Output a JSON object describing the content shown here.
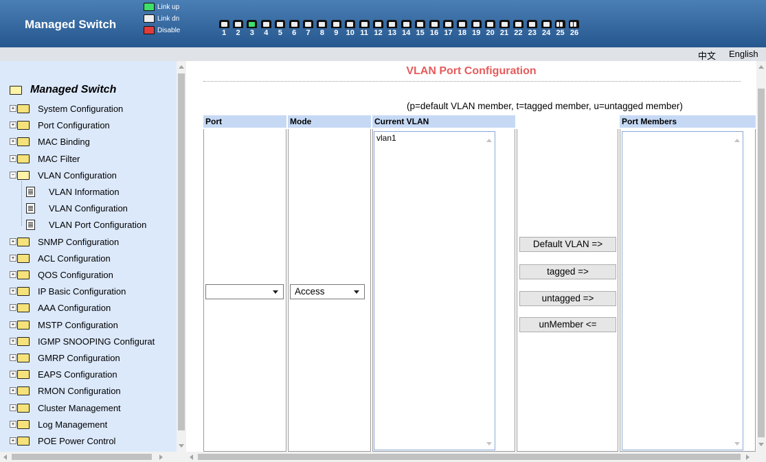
{
  "header": {
    "brand": "Managed Switch",
    "legend": [
      {
        "label": "Link up",
        "color": "#3ee06a"
      },
      {
        "label": "Link dn",
        "color": "#eeeeee"
      },
      {
        "label": "Disable",
        "color": "#e23b3b"
      }
    ],
    "ports": [
      {
        "num": "1",
        "state": "down"
      },
      {
        "num": "2",
        "state": "down"
      },
      {
        "num": "3",
        "state": "up"
      },
      {
        "num": "4",
        "state": "down"
      },
      {
        "num": "5",
        "state": "down"
      },
      {
        "num": "6",
        "state": "down"
      },
      {
        "num": "7",
        "state": "down"
      },
      {
        "num": "8",
        "state": "down"
      },
      {
        "num": "9",
        "state": "down"
      },
      {
        "num": "10",
        "state": "down"
      },
      {
        "num": "11",
        "state": "down"
      },
      {
        "num": "12",
        "state": "down"
      },
      {
        "num": "13",
        "state": "down"
      },
      {
        "num": "14",
        "state": "down"
      },
      {
        "num": "15",
        "state": "down"
      },
      {
        "num": "16",
        "state": "down"
      },
      {
        "num": "17",
        "state": "down"
      },
      {
        "num": "18",
        "state": "down"
      },
      {
        "num": "19",
        "state": "down"
      },
      {
        "num": "20",
        "state": "down"
      },
      {
        "num": "21",
        "state": "down"
      },
      {
        "num": "22",
        "state": "down"
      },
      {
        "num": "23",
        "state": "down"
      },
      {
        "num": "24",
        "state": "down"
      },
      {
        "num": "25",
        "state": "fiber"
      },
      {
        "num": "26",
        "state": "fiber"
      }
    ]
  },
  "language": {
    "chinese": "中文",
    "english": "English"
  },
  "sidebar": {
    "root": "Managed Switch",
    "items": [
      {
        "label": "System Configuration"
      },
      {
        "label": "Port Configuration"
      },
      {
        "label": "MAC Binding"
      },
      {
        "label": "MAC Filter"
      },
      {
        "label": "VLAN Configuration",
        "expanded": true,
        "children": [
          {
            "label": "VLAN Information"
          },
          {
            "label": "VLAN Configuration"
          },
          {
            "label": "VLAN Port Configuration"
          }
        ]
      },
      {
        "label": "SNMP Configuration"
      },
      {
        "label": "ACL Configuration"
      },
      {
        "label": "QOS Configuration"
      },
      {
        "label": "IP Basic Configuration"
      },
      {
        "label": "AAA Configuration"
      },
      {
        "label": "MSTP Configuration"
      },
      {
        "label": "IGMP SNOOPING Configurat"
      },
      {
        "label": "GMRP Configuration"
      },
      {
        "label": "EAPS Configuration"
      },
      {
        "label": "RMON Configuration"
      },
      {
        "label": "Cluster Management"
      },
      {
        "label": "Log Management"
      },
      {
        "label": "POE Power Control"
      }
    ]
  },
  "main": {
    "title": "VLAN Port Configuration",
    "hint": "(p=default VLAN member, t=tagged member, u=untagged member)",
    "columns": {
      "port": "Port",
      "mode": "Mode",
      "current_vlan": "Current VLAN",
      "port_members": "Port Members"
    },
    "port_select": {
      "value": ""
    },
    "mode_select": {
      "value": "Access"
    },
    "current_vlan_list": [
      "vlan1"
    ],
    "port_members_list": [],
    "buttons": {
      "default_vlan": "Default  VLAN =>",
      "tagged": "tagged =>",
      "untagged": "untagged =>",
      "unmember": "unMember <="
    }
  }
}
